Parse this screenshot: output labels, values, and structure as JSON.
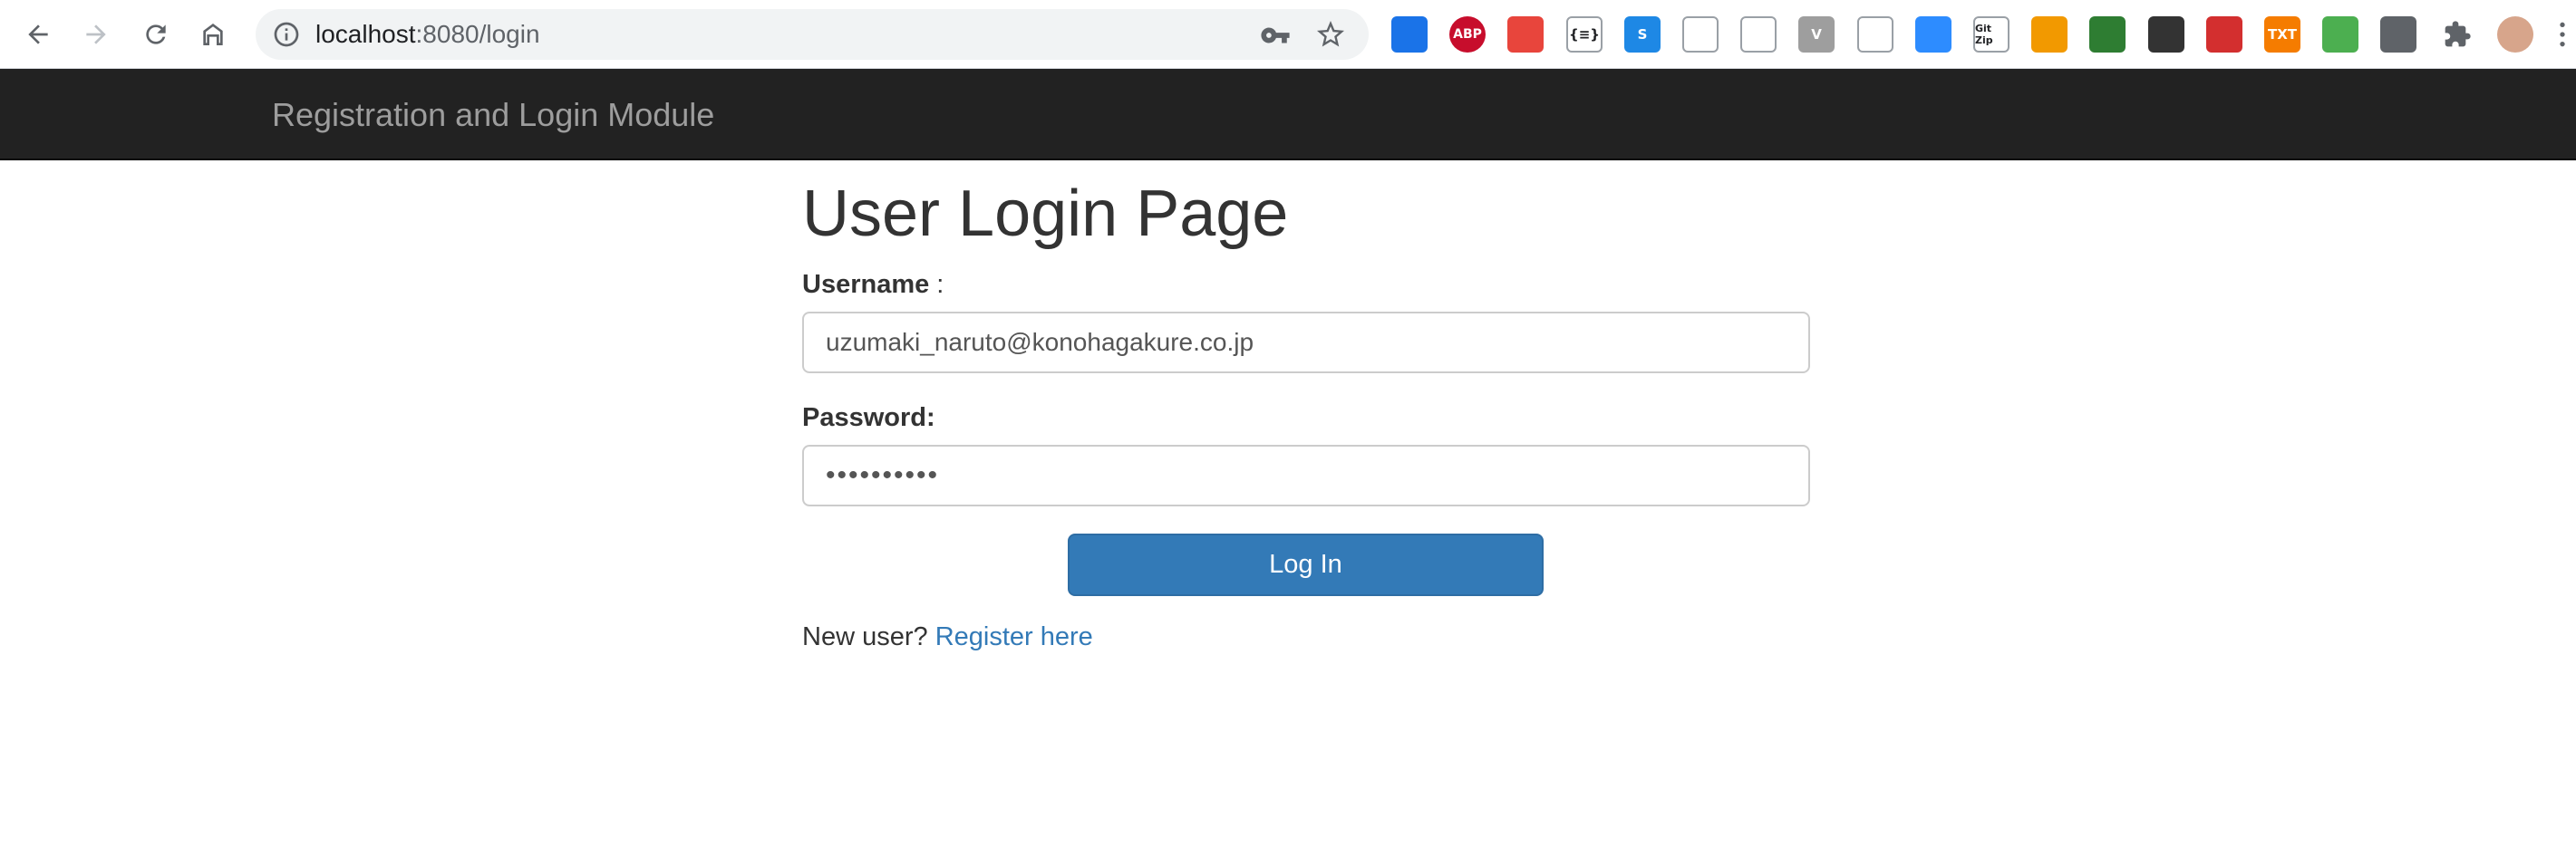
{
  "browser": {
    "url_host": "localhost",
    "url_path": ":8080/login",
    "icons": {
      "back": "back-arrow-icon",
      "forward": "forward-arrow-icon",
      "reload": "reload-icon",
      "home": "home-icon",
      "info": "info-icon",
      "key": "key-icon",
      "star": "star-icon"
    },
    "extensions": [
      {
        "name": "window-extension-icon",
        "label": "",
        "color": "#1a73e8"
      },
      {
        "name": "adblock-plus-icon",
        "label": "ABP",
        "color": "#c70d2c"
      },
      {
        "name": "sitemap-extension-icon",
        "label": "",
        "color": "#e8453c"
      },
      {
        "name": "json-extension-icon",
        "label": "{≡}",
        "color": "#ffffff"
      },
      {
        "name": "s-extension-icon",
        "label": "S",
        "color": "#1e88e5"
      },
      {
        "name": "download-extension-icon",
        "label": "",
        "color": "#dadce0"
      },
      {
        "name": "chat-extension-icon",
        "label": "",
        "color": "#c4c4c4"
      },
      {
        "name": "vue-devtools-icon",
        "label": "V",
        "color": "#9e9e9e"
      },
      {
        "name": "react-devtools-icon",
        "label": "",
        "color": "#e0e0e0"
      },
      {
        "name": "zoom-extension-icon",
        "label": "",
        "color": "#2d8cff"
      },
      {
        "name": "gitzip-extension-icon",
        "label": "Git Zip",
        "color": "#ffffff"
      },
      {
        "name": "image-extension-icon",
        "label": "",
        "color": "#f29900"
      },
      {
        "name": "evernote-like-extension-icon",
        "label": "",
        "color": "#2e7d32"
      },
      {
        "name": "sync-extension-icon",
        "label": "",
        "color": "#333333"
      },
      {
        "name": "record-extension-icon",
        "label": "",
        "color": "#d32f2f"
      },
      {
        "name": "txt-extension-icon",
        "label": "TXT",
        "color": "#f57c00"
      },
      {
        "name": "gear-extension-icon",
        "label": "",
        "color": "#4caf50"
      },
      {
        "name": "bracket-extension-icon",
        "label": "",
        "color": "#5f6368"
      },
      {
        "name": "puzzle-extensions-icon",
        "label": "",
        "color": "#5f6368"
      },
      {
        "name": "profile-avatar-icon",
        "label": "",
        "color": "#d7a58b"
      },
      {
        "name": "menu-kebab-icon",
        "label": "",
        "color": "#5f6368"
      }
    ]
  },
  "navbar": {
    "brand": "Registration and Login Module"
  },
  "form": {
    "title": "User Login Page",
    "username_label": "Username",
    "username_label_suffix": " :",
    "username_value": "uzumaki_naruto@konohagakure.co.jp",
    "password_label": "Password:",
    "password_value": "••••••••••",
    "submit_label": "Log In",
    "new_user_text": "New user?",
    "register_link": "Register here"
  }
}
